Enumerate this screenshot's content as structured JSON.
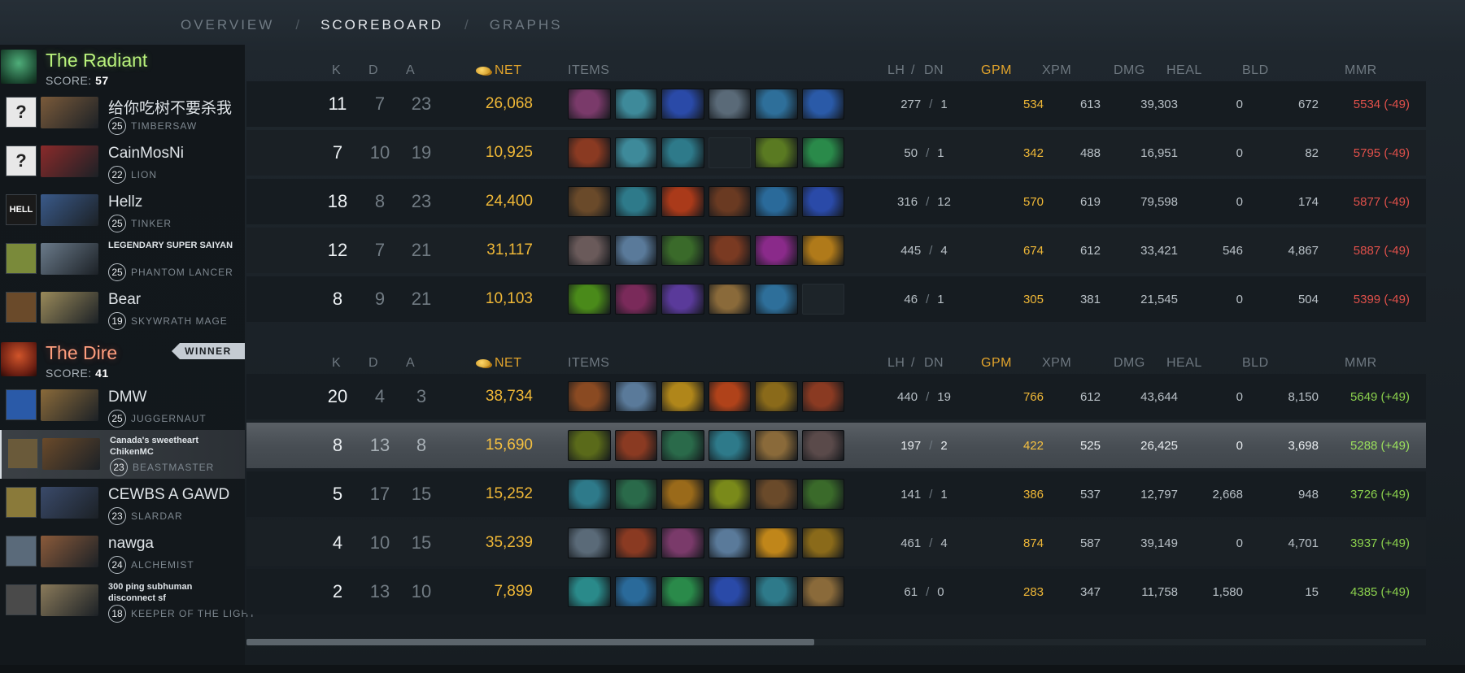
{
  "nav": {
    "tabs": [
      {
        "label": "OVERVIEW",
        "active": false
      },
      {
        "label": "SCOREBOARD",
        "active": true
      },
      {
        "label": "GRAPHS",
        "active": false
      }
    ],
    "separator": "/"
  },
  "columns": {
    "k": "K",
    "d": "D",
    "a": "A",
    "net": "NET",
    "items": "ITEMS",
    "lh": "LH",
    "slash": "/",
    "dn": "DN",
    "gpm": "GPM",
    "xpm": "XPM",
    "dmg": "DMG",
    "heal": "HEAL",
    "bld": "BLD",
    "mmr": "MMR"
  },
  "radiant": {
    "name": "The Radiant",
    "score_label": "SCORE:",
    "score": "57",
    "players": [
      {
        "avatar": "?",
        "name": "给你吃树不要杀我",
        "level": "25",
        "hero": "TIMBERSAW",
        "k": "11",
        "d": "7",
        "a": "23",
        "net": "26,068",
        "lh": "277",
        "dn": "1",
        "gpm": "534",
        "xpm": "613",
        "dmg": "39,303",
        "heal": "0",
        "bld": "672",
        "mmr": "5534 (-49)",
        "items": [
          "#7a3a6a",
          "#3e8a9a",
          "#2a4aa8",
          "#5a6a78",
          "#2e6f9a",
          "#2a5aa8"
        ]
      },
      {
        "avatar": "?",
        "name": "CainMosNi",
        "level": "22",
        "hero": "LION",
        "k": "7",
        "d": "10",
        "a": "19",
        "net": "10,925",
        "lh": "50",
        "dn": "1",
        "gpm": "342",
        "xpm": "488",
        "dmg": "16,951",
        "heal": "0",
        "bld": "82",
        "mmr": "5795 (-49)",
        "items": [
          "#8a3a22",
          "#3e8a9a",
          "#2e7a8a",
          "empty",
          "#5a7a22",
          "#2a8a4a"
        ]
      },
      {
        "avatar": "HELL",
        "name": "Hellz",
        "level": "25",
        "hero": "TINKER",
        "k": "18",
        "d": "8",
        "a": "23",
        "net": "24,400",
        "lh": "316",
        "dn": "12",
        "gpm": "570",
        "xpm": "619",
        "dmg": "79,598",
        "heal": "0",
        "bld": "174",
        "mmr": "5877 (-49)",
        "items": [
          "#6a4a2a",
          "#2e7a8a",
          "#aa3a1a",
          "#6a3a22",
          "#2a6a9a",
          "#2a4aa8"
        ]
      },
      {
        "avatar": "",
        "name": "LEGENDARY SUPER SAIYAN",
        "level": "25",
        "hero": "PHANTOM LANCER",
        "k": "12",
        "d": "7",
        "a": "21",
        "net": "31,117",
        "lh": "445",
        "dn": "4",
        "gpm": "674",
        "xpm": "612",
        "dmg": "33,421",
        "heal": "546",
        "bld": "4,867",
        "mmr": "5887 (-49)",
        "items": [
          "#6a5a5a",
          "#5a7a9a",
          "#3a6a2a",
          "#7a3a22",
          "#8a2a8a",
          "#b07a1a"
        ]
      },
      {
        "avatar": "",
        "name": "Bear",
        "level": "19",
        "hero": "SKYWRATH MAGE",
        "k": "8",
        "d": "9",
        "a": "21",
        "net": "10,103",
        "lh": "46",
        "dn": "1",
        "gpm": "305",
        "xpm": "381",
        "dmg": "21,545",
        "heal": "0",
        "bld": "504",
        "mmr": "5399 (-49)",
        "items": [
          "#4a8a1a",
          "#7a2a5a",
          "#5a3a9a",
          "#8a6a3a",
          "#2e6f9a",
          "empty"
        ]
      }
    ]
  },
  "dire": {
    "name": "The Dire",
    "score_label": "SCORE:",
    "score": "41",
    "winner_label": "WINNER",
    "players": [
      {
        "avatar": "",
        "name": "DMW",
        "level": "25",
        "hero": "JUGGERNAUT",
        "k": "20",
        "d": "4",
        "a": "3",
        "net": "38,734",
        "lh": "440",
        "dn": "19",
        "gpm": "766",
        "xpm": "612",
        "dmg": "43,644",
        "heal": "0",
        "bld": "8,150",
        "mmr": "5649 (+49)",
        "items": [
          "#8a4a22",
          "#5a7a9a",
          "#b0861a",
          "#b0421a",
          "#8a6a1a",
          "#8a3a22"
        ]
      },
      {
        "avatar": "",
        "name": "Canada's sweetheart ChikenMC",
        "level": "23",
        "hero": "BEASTMASTER",
        "k": "8",
        "d": "13",
        "a": "8",
        "net": "15,690",
        "lh": "197",
        "dn": "2",
        "gpm": "422",
        "xpm": "525",
        "dmg": "26,425",
        "heal": "0",
        "bld": "3,698",
        "mmr": "5288 (+49)",
        "items": [
          "#5a6a1a",
          "#8a3a22",
          "#2a6a4a",
          "#2e7a8a",
          "#8a6a3a",
          "#5a4a4a"
        ]
      },
      {
        "avatar": "",
        "name": "CEWBS A GAWD",
        "level": "23",
        "hero": "SLARDAR",
        "k": "5",
        "d": "17",
        "a": "15",
        "net": "15,252",
        "lh": "141",
        "dn": "1",
        "gpm": "386",
        "xpm": "537",
        "dmg": "12,797",
        "heal": "2,668",
        "bld": "948",
        "mmr": "3726 (+49)",
        "items": [
          "#2e7a8a",
          "#2a6a4a",
          "#9a6a1a",
          "#7a8a1a",
          "#6a4a2a",
          "#3a6a2a"
        ]
      },
      {
        "avatar": "",
        "name": "nawga",
        "level": "24",
        "hero": "ALCHEMIST",
        "k": "4",
        "d": "10",
        "a": "15",
        "net": "35,239",
        "lh": "461",
        "dn": "4",
        "gpm": "874",
        "xpm": "587",
        "dmg": "39,149",
        "heal": "0",
        "bld": "4,701",
        "mmr": "3937 (+49)",
        "items": [
          "#5a6a78",
          "#8a3a22",
          "#7a3a6a",
          "#5a7a9a",
          "#c0861a",
          "#8a6a1a"
        ]
      },
      {
        "avatar": "",
        "name": "300 ping subhuman disconnect sf",
        "level": "18",
        "hero": "KEEPER OF THE LIGHT",
        "k": "2",
        "d": "13",
        "a": "10",
        "net": "7,899",
        "lh": "61",
        "dn": "0",
        "gpm": "283",
        "xpm": "347",
        "dmg": "11,758",
        "heal": "1,580",
        "bld": "15",
        "mmr": "4385 (+49)",
        "items": [
          "#2a8a8a",
          "#2a6a9a",
          "#2a8a4a",
          "#2a4aa8",
          "#2e7a8a",
          "#8a6a3a"
        ]
      }
    ]
  },
  "portraits": {
    "radiant": [
      "#7a5a3a",
      "#8a2a2a",
      "#3a5a8a",
      "#6a7a8a",
      "#9a8a5a"
    ],
    "dire": [
      "#8a6a3a",
      "#6a4a2a",
      "#3a4a6a",
      "#8a5a3a",
      "#8a7a5a"
    ]
  },
  "avatars": {
    "radiant": [
      "#e8e8e8",
      "#e8e8e8",
      "#1a1a1a",
      "#7a8a3a",
      "#6a4a2a"
    ],
    "dire": [
      "#2a5aa8",
      "#6a5a3a",
      "#8a7a3a",
      "#5a6a7a",
      "#4a4a4a"
    ]
  }
}
